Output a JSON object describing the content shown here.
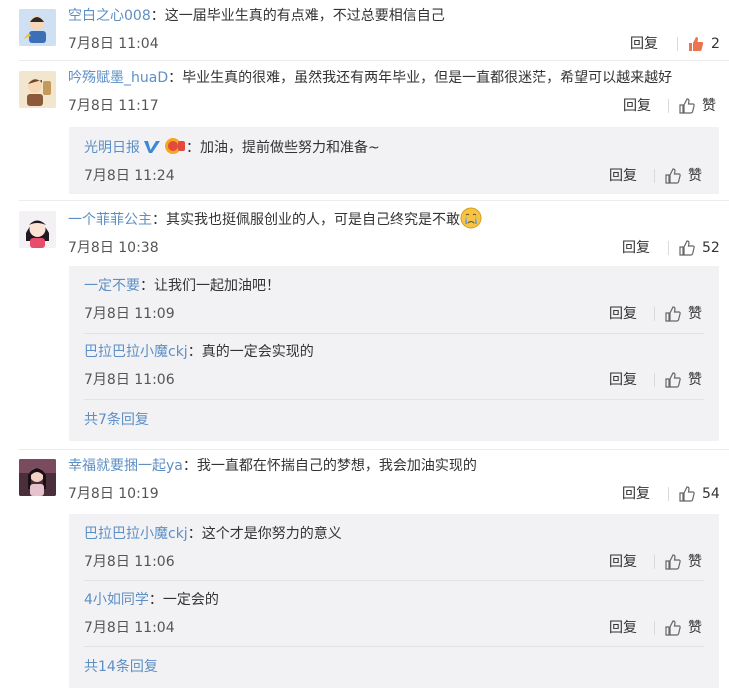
{
  "comments": [
    {
      "user": "空白之心008",
      "text": "这一届毕业生真的有点难，不过总要相信自己",
      "time": "7月8日 11:04",
      "reply": "回复",
      "like": "2",
      "liked": true,
      "avatar_color": "#d6e6f5"
    },
    {
      "user": "吟殇赋墨_huaD",
      "text": "毕业生真的很难，虽然我还有两年毕业，但是一直都很迷茫，希望可以越来越好",
      "time": "7月8日 11:17",
      "reply": "回复",
      "like": "赞",
      "avatar_color": "#f3e7cf",
      "replies": [
        {
          "user": "光明日报",
          "text": "加油，提前做些努力和准备~",
          "time": "7月8日 11:24",
          "reply": "回复",
          "like": "赞"
        }
      ]
    },
    {
      "user": "一个菲菲公主",
      "text": "其实我也挺佩服创业的人，可是自己终究是不敢",
      "time": "7月8日 10:38",
      "reply": "回复",
      "like": "52",
      "avatar_color": "#f1eef3",
      "replies": [
        {
          "user": "一定不要",
          "text": "让我们一起加油吧！",
          "time": "7月8日 11:09",
          "reply": "回复",
          "like": "赞"
        },
        {
          "user": "巴拉巴拉小魔ckj",
          "text": "真的一定会实现的",
          "time": "7月8日 11:06",
          "reply": "回复",
          "like": "赞"
        }
      ],
      "more": "共7条回复"
    },
    {
      "user": "幸福就要捆一起ya",
      "text": "我一直都在怀揣自己的梦想，我会加油实现的",
      "time": "7月8日 10:19",
      "reply": "回复",
      "like": "54",
      "avatar_color": "#5a3a46",
      "replies": [
        {
          "user": "巴拉巴拉小魔ckj",
          "text": "这个才是你努力的意义",
          "time": "7月8日 11:06",
          "reply": "回复",
          "like": "赞"
        },
        {
          "user": "4小如同学",
          "text": "一定会的",
          "time": "7月8日 11:04",
          "reply": "回复",
          "like": "赞"
        }
      ],
      "more": "共14条回复"
    }
  ],
  "colors": {
    "link": "#5d8fc4",
    "liked": "#eb7350",
    "box": "#f2f2f5"
  }
}
